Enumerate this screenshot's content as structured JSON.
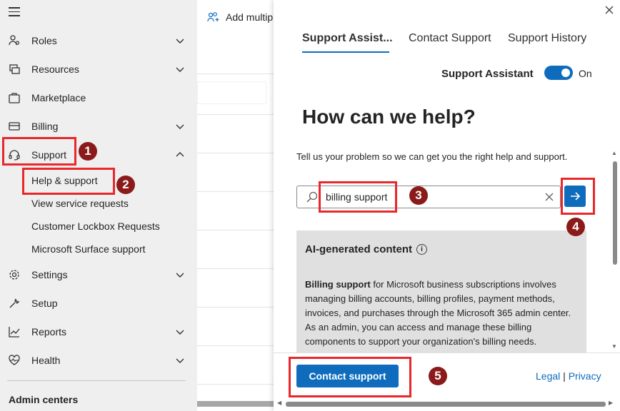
{
  "sidebar": {
    "items": [
      {
        "label": "Roles",
        "icon": "roles-icon",
        "expandable": true
      },
      {
        "label": "Resources",
        "icon": "resources-icon",
        "expandable": true
      },
      {
        "label": "Marketplace",
        "icon": "marketplace-icon",
        "expandable": false
      },
      {
        "label": "Billing",
        "icon": "billing-icon",
        "expandable": true
      },
      {
        "label": "Support",
        "icon": "support-headset-icon",
        "expandable": true,
        "expanded": true
      },
      {
        "label": "Settings",
        "icon": "gear-icon",
        "expandable": true
      },
      {
        "label": "Setup",
        "icon": "wrench-icon",
        "expandable": false
      },
      {
        "label": "Reports",
        "icon": "chart-icon",
        "expandable": true
      },
      {
        "label": "Health",
        "icon": "heart-pulse-icon",
        "expandable": true
      }
    ],
    "support_subitems": [
      {
        "label": "Help & support"
      },
      {
        "label": "View service requests"
      },
      {
        "label": "Customer Lockbox Requests"
      },
      {
        "label": "Microsoft Surface support"
      }
    ],
    "admin_centers_label": "Admin centers"
  },
  "toolbar": {
    "add_multiple_label": "Add multip"
  },
  "panel": {
    "tabs": [
      {
        "label": "Support Assist...",
        "active": true
      },
      {
        "label": "Contact Support",
        "active": false
      },
      {
        "label": "Support History",
        "active": false
      }
    ],
    "assistant_label": "Support Assistant",
    "assistant_toggle_state": "On",
    "title": "How can we help?",
    "description": "Tell us your problem so we can get you the right help and support.",
    "search_value": "billing support",
    "ai_heading": "AI-generated content",
    "ai_bold": "Billing support",
    "ai_text": " for Microsoft business subscriptions involves managing billing accounts, billing profiles, payment methods, invoices, and purchases through the Microsoft 365 admin center. As an admin, you can access and manage these billing components to support your organization's billing needs.",
    "contact_button": "Contact support",
    "legal_link": "Legal",
    "link_separator": "|",
    "privacy_link": "Privacy"
  },
  "annotations": [
    "1",
    "2",
    "3",
    "4",
    "5"
  ],
  "colors": {
    "accent": "#0f6cbd",
    "annotation_red": "#e8282b",
    "badge": "#8b1a1a",
    "sidebar_bg": "#efefef"
  }
}
